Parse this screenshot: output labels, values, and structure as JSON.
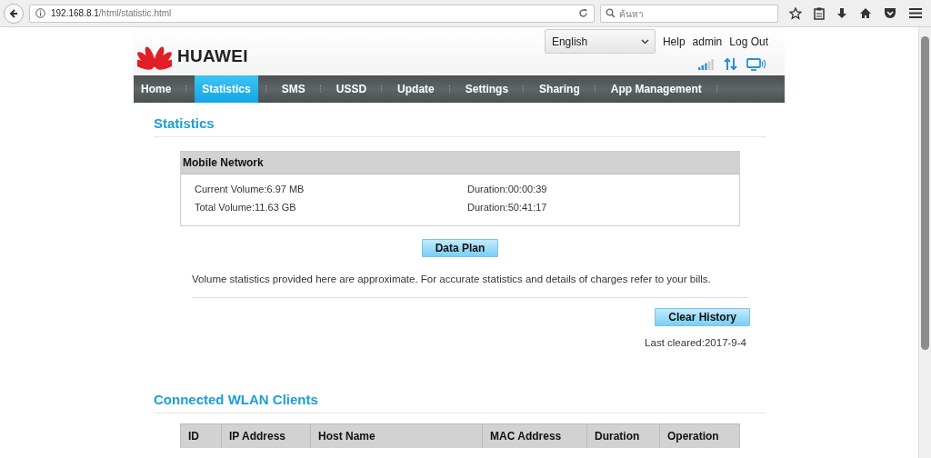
{
  "browser": {
    "url_host": "192.168.8.1",
    "url_path": "/html/statistic.html",
    "search_placeholder": "ค้นหา"
  },
  "header": {
    "logo": "HUAWEI",
    "language": "English",
    "links": [
      "Help",
      "admin",
      "Log Out"
    ]
  },
  "nav": [
    {
      "label": "Home",
      "selected": false
    },
    {
      "label": "Statistics",
      "selected": true
    },
    {
      "label": "SMS",
      "selected": false
    },
    {
      "label": "USSD",
      "selected": false
    },
    {
      "label": "Update",
      "selected": false
    },
    {
      "label": "Settings",
      "selected": false
    },
    {
      "label": "Sharing",
      "selected": false
    },
    {
      "label": "App Management",
      "selected": false
    }
  ],
  "statistics": {
    "title": "Statistics",
    "panel_title": "Mobile Network",
    "rows": [
      {
        "volume": "Current Volume:6.97 MB",
        "duration": "Duration:00:00:39"
      },
      {
        "volume": "Total Volume:11.63 GB",
        "duration": "Duration:50:41:17"
      }
    ],
    "data_plan_button": "Data Plan",
    "notice": "Volume statistics provided here are approximate. For accurate statistics and details of charges refer to your bills.",
    "clear_button": "Clear History",
    "last_cleared": "Last cleared:2017-9-4"
  },
  "wlan": {
    "title": "Connected WLAN Clients",
    "columns": [
      "ID",
      "IP Address",
      "Host Name",
      "MAC Address",
      "Duration",
      "Operation"
    ]
  }
}
